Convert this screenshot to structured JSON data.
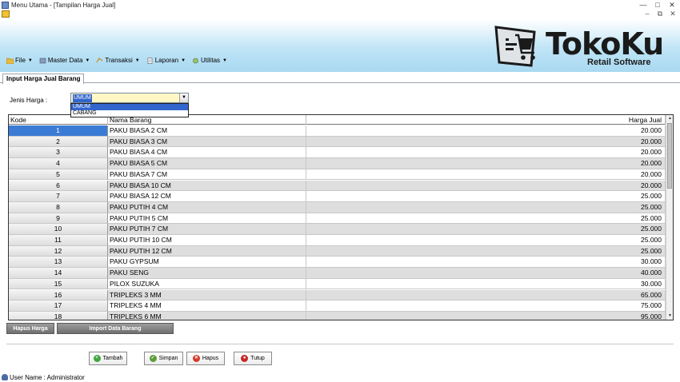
{
  "window": {
    "title": "Menu Utama - [Tampilan Harga Jual]"
  },
  "menu": {
    "items": [
      {
        "label": "File",
        "icon": "folder-icon"
      },
      {
        "label": "Master Data",
        "icon": "database-icon"
      },
      {
        "label": "Transaksi",
        "icon": "transaction-icon"
      },
      {
        "label": "Laporan",
        "icon": "report-icon"
      },
      {
        "label": "Utilitas",
        "icon": "tools-icon"
      }
    ]
  },
  "logo": {
    "name": "TokoKu",
    "tagline": "Retail Software"
  },
  "tab": {
    "label": "Input Harga Jual Barang"
  },
  "form": {
    "jenis_label": "Jenis Harga :",
    "jenis_value": "UMUM",
    "options": [
      "UMUM",
      "CABANG"
    ]
  },
  "grid": {
    "headers": [
      "Kode",
      "Nama Barang",
      "Harga Jual"
    ],
    "rows": [
      [
        "1",
        "PAKU BIASA 2 CM",
        "20.000"
      ],
      [
        "2",
        "PAKU BIASA 3 CM",
        "20.000"
      ],
      [
        "3",
        "PAKU BIASA 4 CM",
        "20.000"
      ],
      [
        "4",
        "PAKU BIASA 5 CM",
        "20.000"
      ],
      [
        "5",
        "PAKU BIASA 7 CM",
        "20.000"
      ],
      [
        "6",
        "PAKU BIASA 10 CM",
        "20.000"
      ],
      [
        "7",
        "PAKU BIASA 12 CM",
        "25.000"
      ],
      [
        "8",
        "PAKU PUTIH 4 CM",
        "25.000"
      ],
      [
        "9",
        "PAKU PUTIH 5 CM",
        "25.000"
      ],
      [
        "10",
        "PAKU PUTIH 7 CM",
        "25.000"
      ],
      [
        "11",
        "PAKU PUTIH 10 CM",
        "25.000"
      ],
      [
        "12",
        "PAKU PUTIH 12 CM",
        "25.000"
      ],
      [
        "13",
        "PAKU GYPSUM",
        "30.000"
      ],
      [
        "14",
        "PAKU SENG",
        "40.000"
      ],
      [
        "15",
        "PILOX SUZUKA",
        "30.000"
      ],
      [
        "16",
        "TRIPLEKS 3 MM",
        "65.000"
      ],
      [
        "17",
        "TRIPLEKS 4 MM",
        "75.000"
      ],
      [
        "18",
        "TRIPLEKS 6 MM",
        "95.000"
      ]
    ]
  },
  "buttons": {
    "hapus_harga": "Hapus Harga",
    "import": "Import Data Barang",
    "tambah": "Tambah",
    "simpan": "Simpan",
    "hapus": "Hapus",
    "tutup": "Tutup"
  },
  "status": {
    "user": "User Name : Administrator"
  },
  "colors": {
    "selection": "#3366cc",
    "combo_bg": "#fff8c4",
    "row_alt": "#dedede",
    "banner": "#a9d9f1"
  }
}
